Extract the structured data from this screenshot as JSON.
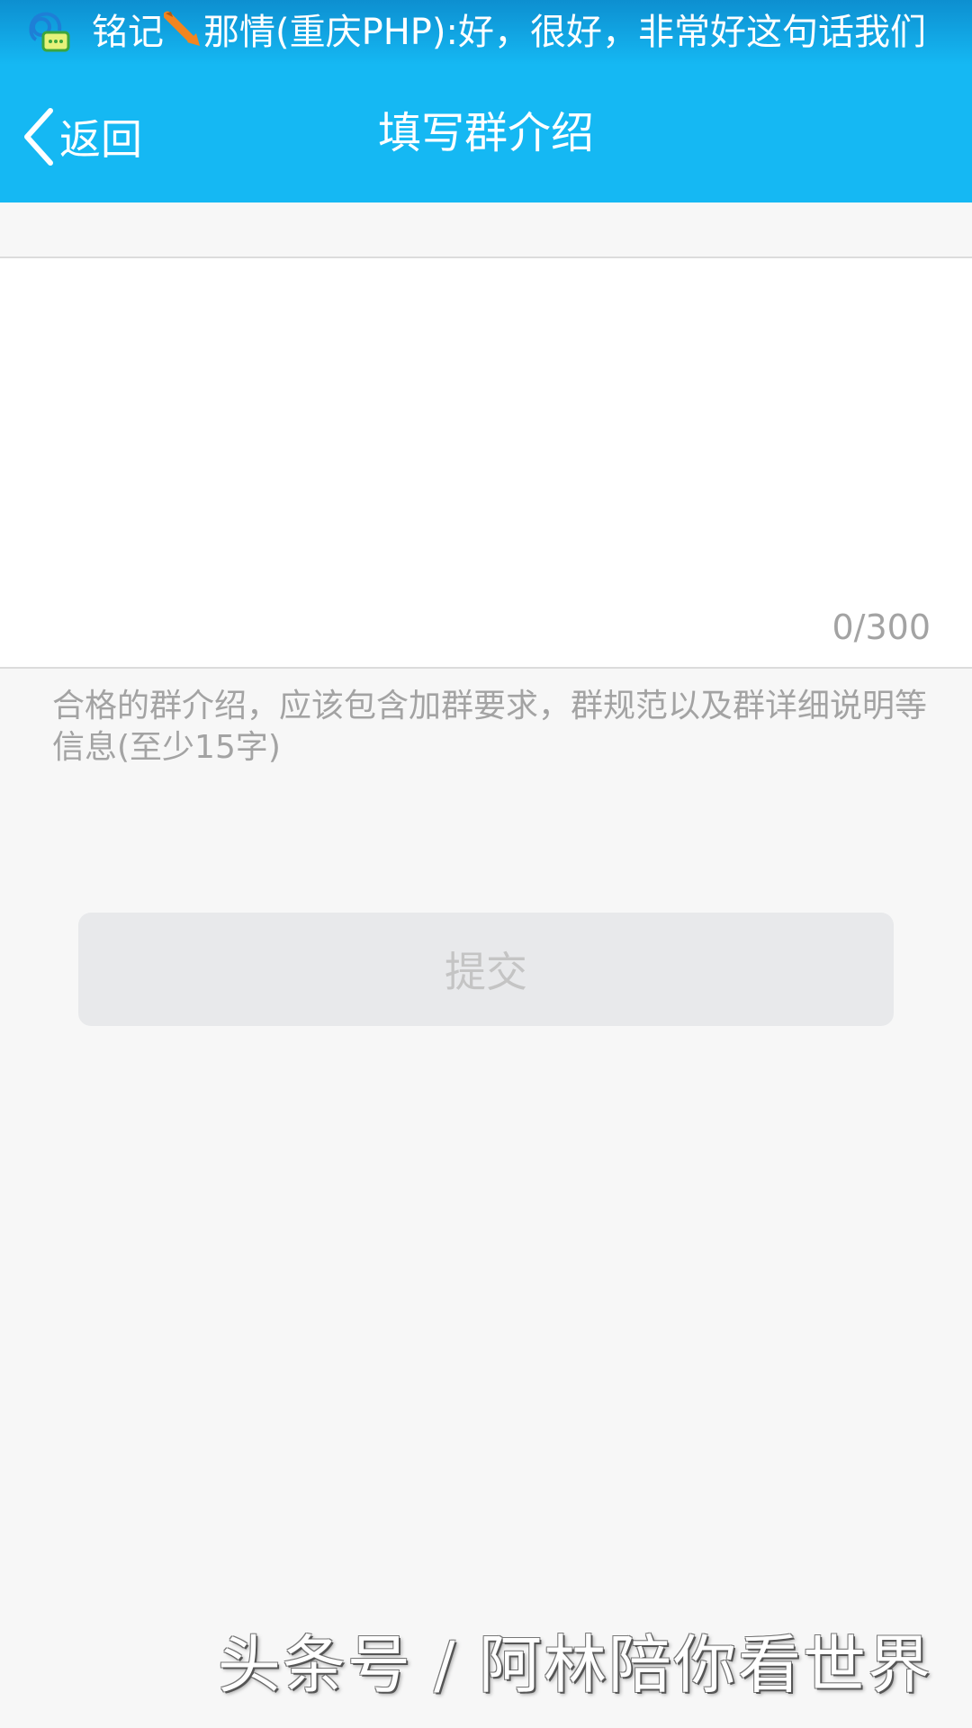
{
  "status_bar": {
    "notification_icon": "qq-chat-icon",
    "sender": "铭记",
    "sender_icon": "pencil-icon",
    "message": "那情(重庆PHP):好，很好，非常好这句话我们"
  },
  "header": {
    "back_label": "返回",
    "title": "填写群介绍"
  },
  "form": {
    "intro_value": "",
    "char_counter": "0/300",
    "hint": "合格的群介绍，应该包含加群要求，群规范以及群详细说明等信息(至少15字)",
    "submit_label": "提交"
  },
  "watermark": "头条号 / 阿林陪你看世界",
  "colors": {
    "accent": "#15b8f3",
    "background": "#f7f7f7",
    "submit_disabled_bg": "#e8e9eb",
    "hint_text": "#a3a3a3"
  }
}
